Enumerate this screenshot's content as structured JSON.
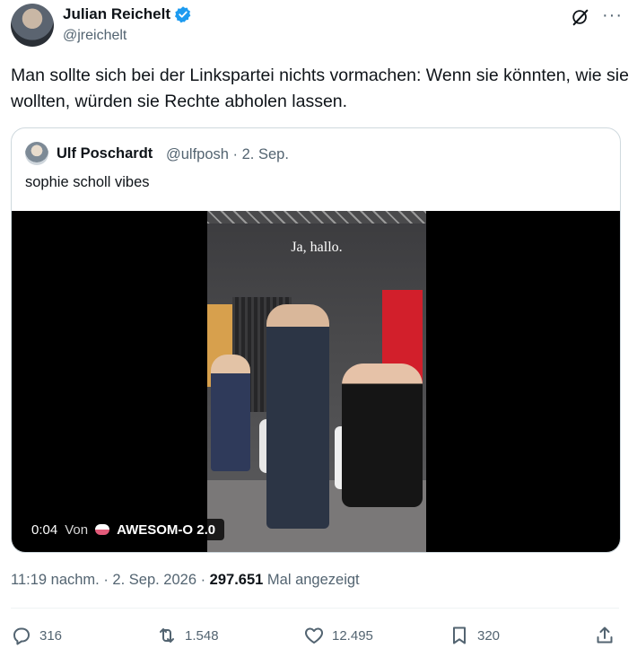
{
  "author": {
    "name": "Julian Reichelt",
    "handle": "@jreichelt",
    "verified_color": "#1d9bf0"
  },
  "header_icons": [
    "grok-icon",
    "more-icon"
  ],
  "more_label": "···",
  "tweet": {
    "text": "Man sollte sich bei der Linkspartei nichts vormachen: Wenn sie könnten, wie sie wollten, würden sie Rechte abholen lassen."
  },
  "quote": {
    "name": "Ulf Poschardt",
    "meta": "@ulfposh · 2. Sep.",
    "text": "sophie scholl vibes",
    "video": {
      "subtitle": "Ja, hallo.",
      "time": "0:04",
      "von": "Von",
      "source": "AWESOM-O 2.0"
    }
  },
  "meta": {
    "time": "11:19 nachm. · 2. Sep. 2026 · ",
    "views": "297.651",
    "views_label": " Mal angezeigt"
  },
  "actions": {
    "replies": "316",
    "reposts": "1.548",
    "likes": "12.495",
    "bookmarks": "320"
  },
  "colors": {
    "text": "#0f1419",
    "secondary": "#536471",
    "border": "#cfd9de",
    "accent": "#1d9bf0"
  }
}
